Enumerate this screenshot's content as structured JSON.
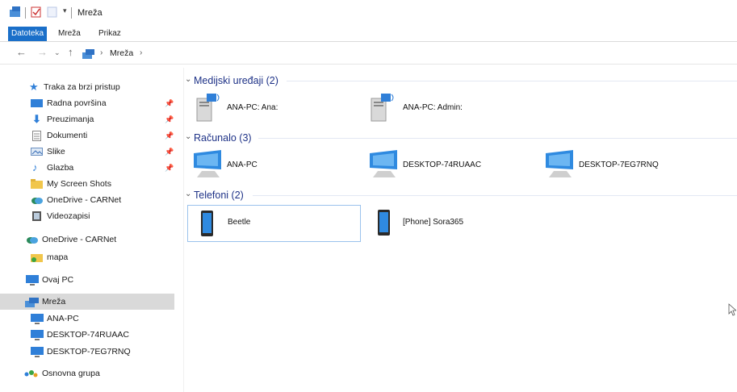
{
  "window": {
    "title": "Mreža"
  },
  "ribbon": {
    "tabs": [
      "Datoteka",
      "Mreža",
      "Prikaz"
    ]
  },
  "address": {
    "path": "Mreža"
  },
  "sidebar": {
    "quick_access": "Traka za brzi pristup",
    "quick_items": [
      {
        "label": "Radna površina",
        "pinned": true
      },
      {
        "label": "Preuzimanja",
        "pinned": true
      },
      {
        "label": "Dokumenti",
        "pinned": true
      },
      {
        "label": "Slike",
        "pinned": true
      },
      {
        "label": "Glazba",
        "pinned": true
      },
      {
        "label": "My Screen Shots",
        "pinned": false
      },
      {
        "label": "OneDrive - CARNet",
        "pinned": false
      },
      {
        "label": "Videozapisi",
        "pinned": false
      }
    ],
    "onedrive": "OneDrive - CARNet",
    "mapa": "mapa",
    "this_pc": "Ovaj PC",
    "network": "Mreža",
    "network_items": [
      "ANA-PC",
      "DESKTOP-74RUAAC",
      "DESKTOP-7EG7RNQ"
    ],
    "homegroup": "Osnovna grupa"
  },
  "groups": {
    "media": {
      "header": "Medijski uređaji (2)",
      "items": [
        "ANA-PC: Ana:",
        "ANA-PC: Admin:"
      ]
    },
    "computers": {
      "header": "Računalo (3)",
      "items": [
        "ANA-PC",
        "DESKTOP-74RUAAC",
        "DESKTOP-7EG7RNQ"
      ]
    },
    "phones": {
      "header": "Telefoni (2)",
      "items": [
        "Beetle",
        "[Phone] Sora365"
      ]
    }
  },
  "colors": {
    "accent": "#1a6fc9",
    "group_header": "#1e3287",
    "selection": "#d9d9d9"
  }
}
